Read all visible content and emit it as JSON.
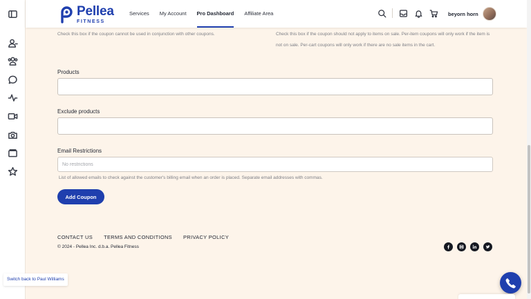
{
  "rail": {
    "icons": [
      "sidebar-toggle-icon",
      "user-icon",
      "users-icon",
      "chat-icon",
      "activity-icon",
      "video-icon",
      "camera-icon",
      "folder-icon",
      "star-icon"
    ]
  },
  "header": {
    "brand_name": "Pellea",
    "brand_sub": "FITNESS",
    "nav": [
      {
        "label": "Services",
        "active": false
      },
      {
        "label": "My Account",
        "active": false
      },
      {
        "label": "Pro Dashboard",
        "active": true
      },
      {
        "label": "Affiliate Area",
        "active": false
      }
    ],
    "icons": [
      "search-icon",
      "inbox-icon",
      "bell-icon",
      "cart-icon"
    ],
    "user_name": "beyorn horn"
  },
  "form": {
    "individual_use_help": "Check this box if the coupon cannot be used in conjunction with other coupons.",
    "exclude_sale_help": "Check this box if the coupon should not apply to items on sale. Per-item coupons will only work if the item is not on sale. Per-cart coupons will only work if there are no sale items in the cart.",
    "products_label": "Products",
    "products_value": "",
    "exclude_products_label": "Exclude products",
    "exclude_products_value": "",
    "email_label": "Email Restrictions",
    "email_value": "",
    "email_placeholder": "No restrictions",
    "email_help": "List of allowed emails to check against the customer's billing email when an order is placed. Separate email addresses with commas.",
    "submit_label": "Add Coupon"
  },
  "footer": {
    "links": [
      "CONTACT US",
      "TERMS AND CONDITIONS",
      "PRIVACY POLICY"
    ],
    "copyright": "© 2024 - Pellea Inc. d.b.a. Pellea Fitness",
    "socials": [
      "facebook-icon",
      "instagram-icon",
      "linkedin-icon",
      "twitter-icon"
    ]
  },
  "switch_back": "Switch back to Paul Williams",
  "colors": {
    "brand": "#1f3fae",
    "page_bg": "#fdf4ea",
    "text": "#1f2430",
    "muted": "#7d7f86"
  }
}
